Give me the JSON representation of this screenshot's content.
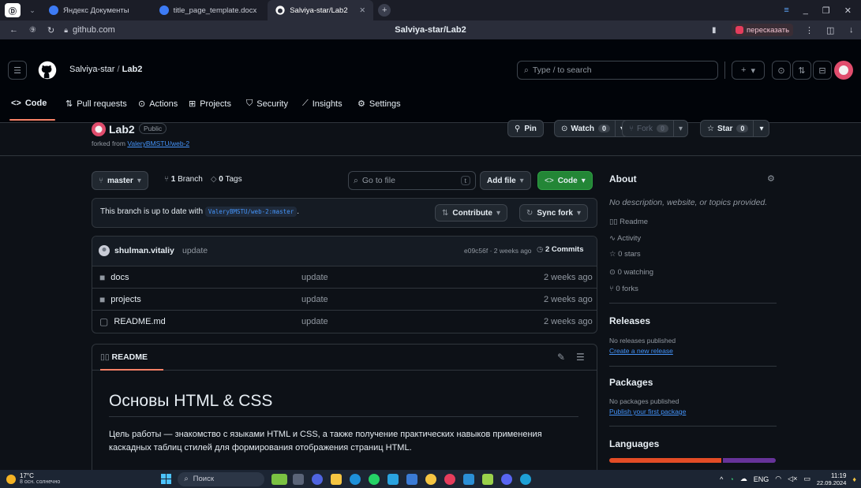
{
  "browser": {
    "tabs": [
      {
        "label": "Яндекс Документы",
        "color": "#3d7bf5"
      },
      {
        "label": "title_page_template.docx",
        "color": "#3d7bf5"
      },
      {
        "label": "Salviya-star/Lab2",
        "color": "#ffffff"
      }
    ],
    "domain": "github.com",
    "page_title": "Salviya-star/Lab2",
    "retell_label": "пересказать"
  },
  "header": {
    "owner": "Salviya-star",
    "separator": "/",
    "repo": "Lab2",
    "search_placeholder": "Type / to search"
  },
  "repo_nav": {
    "items": [
      "Code",
      "Pull requests",
      "Actions",
      "Projects",
      "Security",
      "Insights",
      "Settings"
    ]
  },
  "repo_head": {
    "name": "Lab2",
    "visibility": "Public",
    "forked_prefix": "forked from",
    "forked_from": "ValeryBMSTU/web-2",
    "pin": "Pin",
    "watch": "Watch",
    "watch_count": "0",
    "fork": "Fork",
    "fork_count": "0",
    "star": "Star",
    "star_count": "0"
  },
  "toolbar": {
    "branch": "master",
    "branches_count": "1",
    "branches_label": "Branch",
    "tags_count": "0",
    "tags_label": "Tags",
    "goto_placeholder": "Go to file",
    "goto_key": "t",
    "add_file": "Add file",
    "code": "Code"
  },
  "sync": {
    "text": "This branch is up to date with",
    "ref": "ValeryBMSTU/web-2:master",
    "period": ".",
    "contribute": "Contribute",
    "sync_fork": "Sync fork"
  },
  "commit": {
    "author": "shulman.vitaliy",
    "message": "update",
    "meta": "e09c56f · 2 weeks ago",
    "commits": "2 Commits"
  },
  "files": [
    {
      "name": "docs",
      "type": "folder",
      "message": "update",
      "age": "2 weeks ago"
    },
    {
      "name": "projects",
      "type": "folder",
      "message": "update",
      "age": "2 weeks ago"
    },
    {
      "name": "README.md",
      "type": "file",
      "message": "update",
      "age": "2 weeks ago"
    }
  ],
  "readme": {
    "tab": "README",
    "heading": "Основы HTML & CSS",
    "para": "Цель работы — знакомство с языками HTML и CSS, а также получение практических навыков применения каскадных таблиц стилей для формирования отображения страниц HTML."
  },
  "about": {
    "title": "About",
    "description": "No description, website, or topics provided.",
    "readme": "Readme",
    "activity": "Activity",
    "stars": "0 stars",
    "watching": "0 watching",
    "forks": "0 forks"
  },
  "releases": {
    "title": "Releases",
    "none": "No releases published",
    "create": "Create a new release"
  },
  "packages": {
    "title": "Packages",
    "none": "No packages published",
    "publish": "Publish your first package"
  },
  "languages": {
    "title": "Languages",
    "bar": [
      {
        "share": 0.68,
        "color": "#e34c26"
      },
      {
        "share": 0.32,
        "color": "#663399"
      }
    ]
  },
  "taskbar": {
    "temp": "17°C",
    "weather": "8 осн. солнечно",
    "search": "Поиск",
    "lang": "ENG",
    "time": "11:19",
    "date": "22.09.2024"
  }
}
